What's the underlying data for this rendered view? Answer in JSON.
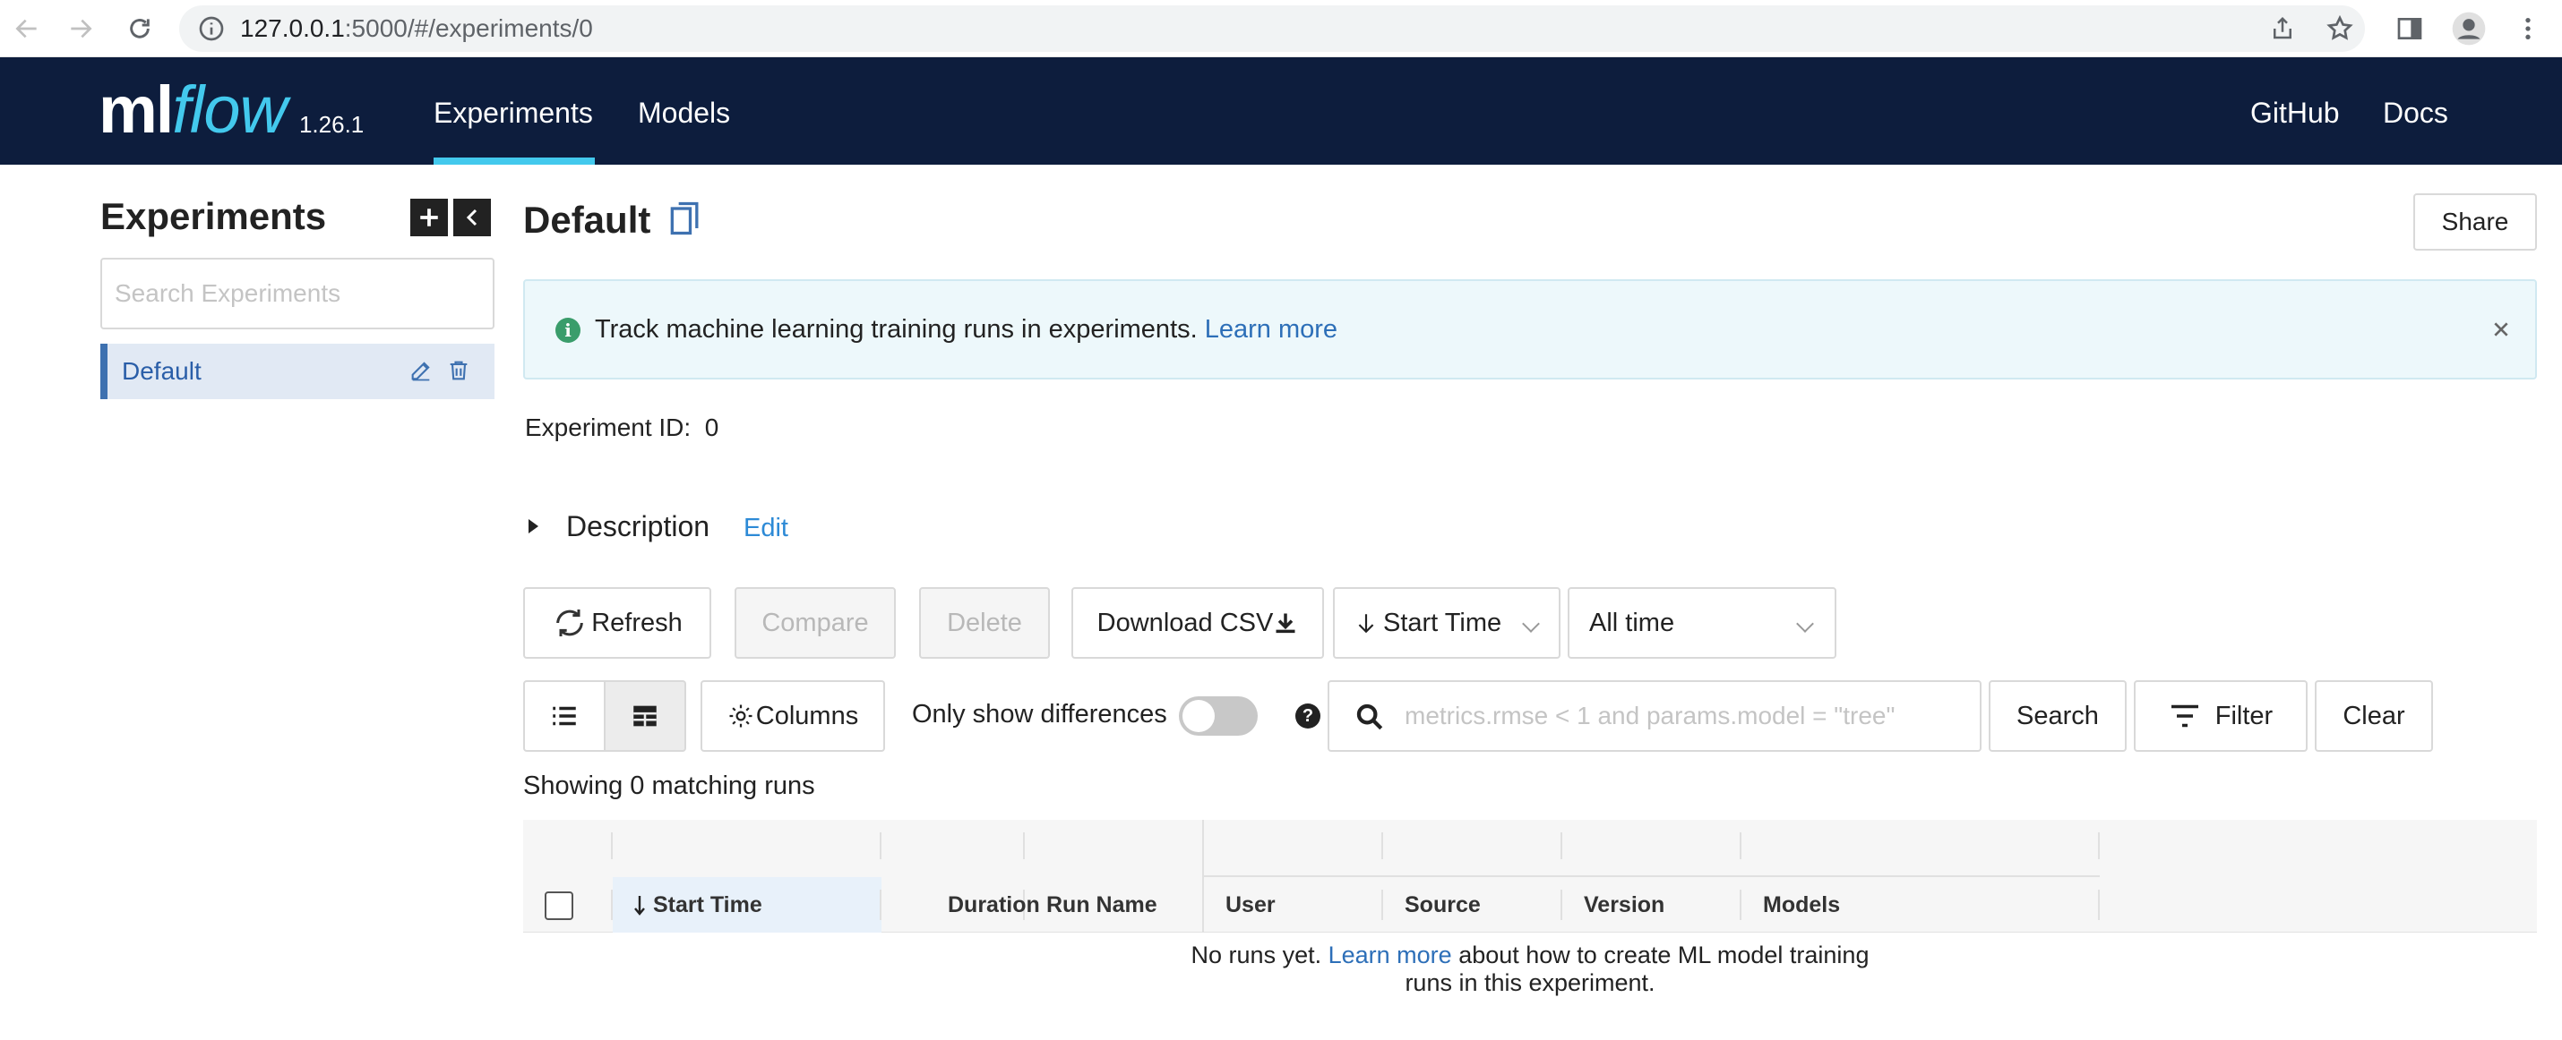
{
  "browser": {
    "url_host": "127.0.0.1",
    "url_rest": ":5000/#/experiments/0"
  },
  "header": {
    "logo_ml": "ml",
    "logo_flow": "flow",
    "version": "1.26.1",
    "nav": [
      "Experiments",
      "Models"
    ],
    "right_links": [
      "GitHub",
      "Docs"
    ]
  },
  "sidebar": {
    "title": "Experiments",
    "search_placeholder": "Search Experiments",
    "items": [
      {
        "label": "Default"
      }
    ]
  },
  "main": {
    "title": "Default",
    "share_label": "Share",
    "banner_text": "Track machine learning training runs in experiments.",
    "banner_link": "Learn more",
    "experiment_id_label": "Experiment ID:",
    "experiment_id_value": "0",
    "description_label": "Description",
    "description_edit": "Edit",
    "toolbar": {
      "refresh": "Refresh",
      "compare": "Compare",
      "delete": "Delete",
      "download": "Download CSV",
      "sort_select": "Start Time",
      "time_select": "All time",
      "columns": "Columns",
      "only_diff": "Only show differences",
      "search_placeholder": "metrics.rmse < 1 and params.model = \"tree\"",
      "search": "Search",
      "filter": "Filter",
      "clear": "Clear"
    },
    "showing_text": "Showing 0 matching runs",
    "columns": [
      "Start Time",
      "Duration",
      "Run Name",
      "User",
      "Source",
      "Version",
      "Models"
    ],
    "empty_text_pre": "No runs yet.",
    "empty_link": "Learn more",
    "empty_text_post_line1": "about how to create ML model training",
    "empty_text_line2": "runs in this experiment."
  },
  "colors": {
    "header_bg": "#0d1d3d",
    "accent": "#43c9ed",
    "link": "#2d6fb8",
    "selected_item_bg": "#e1e9f4"
  }
}
